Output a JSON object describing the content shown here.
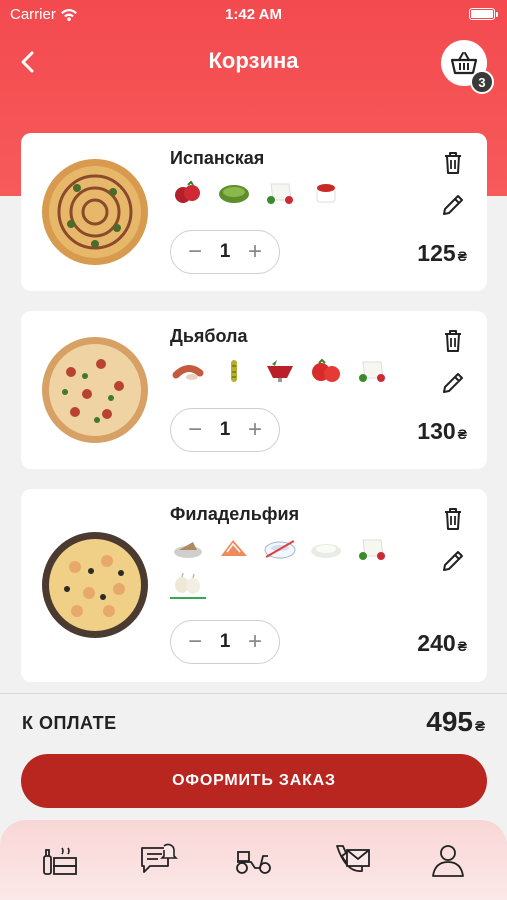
{
  "status_bar": {
    "carrier": "Carrier",
    "time": "1:42 AM"
  },
  "header": {
    "title": "Корзина",
    "cart_count": "3"
  },
  "items": [
    {
      "name": "Испанская",
      "quantity": "1",
      "price": "125",
      "currency": "₴",
      "ingredients": [
        "tomato-icon",
        "pesto-icon",
        "mozzarella-icon",
        "sauce-icon"
      ]
    },
    {
      "name": "Дьябола",
      "quantity": "1",
      "price": "130",
      "currency": "₴",
      "ingredients": [
        "sausage-icon",
        "pickled-pepper-icon",
        "tomato-sauce-icon",
        "tomato-icon",
        "mozzarella-icon"
      ]
    },
    {
      "name": "Филадельфия",
      "quantity": "1",
      "price": "240",
      "currency": "₴",
      "ingredients": [
        "tuna-icon",
        "salmon-icon",
        "cream-cheese-icon",
        "cream-sauce-icon",
        "mozzarella-icon",
        "garlic-icon"
      ]
    }
  ],
  "total": {
    "label": "К ОПЛАТЕ",
    "value": "495",
    "currency": "₴"
  },
  "checkout_button": "ОФОРМИТЬ ЗАКАЗ",
  "tabbar": [
    "menu-icon",
    "chat-icon",
    "delivery-icon",
    "call-icon",
    "profile-icon"
  ],
  "colors": {
    "accent": "#f34a4f",
    "button": "#b8261f"
  }
}
